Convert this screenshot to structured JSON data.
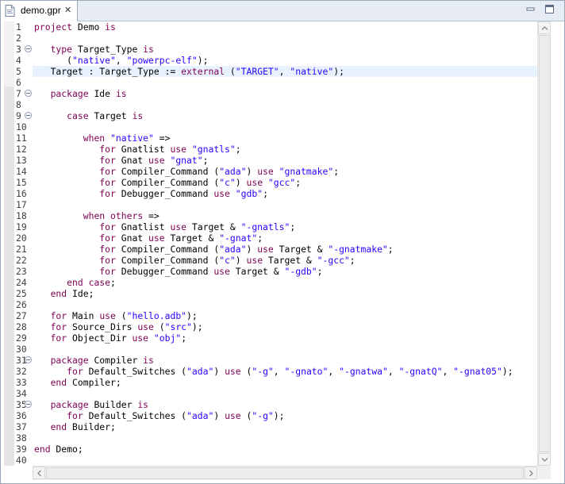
{
  "tab": {
    "title": "demo.gpr",
    "icon": "gpr-file-icon",
    "close_symbol": "✕"
  },
  "window_controls": [
    "minimize-icon",
    "maximize-icon"
  ],
  "colors": {
    "keyword": "#7f0055",
    "string": "#2a00ff",
    "current_line": "#e8f2fe",
    "line_number": "#3f3f3f"
  },
  "editor": {
    "current_line": 5,
    "lines": [
      {
        "n": "1",
        "fold": false,
        "tokens": [
          [
            "k",
            "project"
          ],
          [
            "t",
            " Demo "
          ],
          [
            "k",
            "is"
          ]
        ]
      },
      {
        "n": "2",
        "fold": false,
        "tokens": []
      },
      {
        "n": "3",
        "fold": true,
        "tokens": [
          [
            "t",
            "   "
          ],
          [
            "k",
            "type"
          ],
          [
            "t",
            " Target_Type "
          ],
          [
            "k",
            "is"
          ]
        ]
      },
      {
        "n": "4",
        "fold": false,
        "tokens": [
          [
            "t",
            "      ("
          ],
          [
            "s",
            "\"native\""
          ],
          [
            "t",
            ", "
          ],
          [
            "s",
            "\"powerpc-elf\""
          ],
          [
            "t",
            ");"
          ]
        ]
      },
      {
        "n": "5",
        "fold": false,
        "tokens": [
          [
            "t",
            "   Target : Target_Type := "
          ],
          [
            "k",
            "external"
          ],
          [
            "t",
            " ("
          ],
          [
            "s",
            "\"TARGET\""
          ],
          [
            "t",
            ", "
          ],
          [
            "s",
            "\"native\""
          ],
          [
            "t",
            ");"
          ]
        ]
      },
      {
        "n": "6",
        "fold": false,
        "tokens": []
      },
      {
        "n": "7",
        "fold": true,
        "tokens": [
          [
            "t",
            "   "
          ],
          [
            "k",
            "package"
          ],
          [
            "t",
            " Ide "
          ],
          [
            "k",
            "is"
          ]
        ]
      },
      {
        "n": "8",
        "fold": false,
        "tokens": []
      },
      {
        "n": "9",
        "fold": true,
        "tokens": [
          [
            "t",
            "      "
          ],
          [
            "k",
            "case"
          ],
          [
            "t",
            " Target "
          ],
          [
            "k",
            "is"
          ]
        ]
      },
      {
        "n": "10",
        "fold": false,
        "tokens": []
      },
      {
        "n": "11",
        "fold": false,
        "tokens": [
          [
            "t",
            "         "
          ],
          [
            "k",
            "when"
          ],
          [
            "t",
            " "
          ],
          [
            "s",
            "\"native\""
          ],
          [
            "t",
            " =>"
          ]
        ]
      },
      {
        "n": "12",
        "fold": false,
        "tokens": [
          [
            "t",
            "            "
          ],
          [
            "k",
            "for"
          ],
          [
            "t",
            " Gnatlist "
          ],
          [
            "k",
            "use"
          ],
          [
            "t",
            " "
          ],
          [
            "s",
            "\"gnatls\""
          ],
          [
            "t",
            ";"
          ]
        ]
      },
      {
        "n": "13",
        "fold": false,
        "tokens": [
          [
            "t",
            "            "
          ],
          [
            "k",
            "for"
          ],
          [
            "t",
            " Gnat "
          ],
          [
            "k",
            "use"
          ],
          [
            "t",
            " "
          ],
          [
            "s",
            "\"gnat\""
          ],
          [
            "t",
            ";"
          ]
        ]
      },
      {
        "n": "14",
        "fold": false,
        "tokens": [
          [
            "t",
            "            "
          ],
          [
            "k",
            "for"
          ],
          [
            "t",
            " Compiler_Command ("
          ],
          [
            "s",
            "\"ada\""
          ],
          [
            "t",
            ") "
          ],
          [
            "k",
            "use"
          ],
          [
            "t",
            " "
          ],
          [
            "s",
            "\"gnatmake\""
          ],
          [
            "t",
            ";"
          ]
        ]
      },
      {
        "n": "15",
        "fold": false,
        "tokens": [
          [
            "t",
            "            "
          ],
          [
            "k",
            "for"
          ],
          [
            "t",
            " Compiler_Command ("
          ],
          [
            "s",
            "\"c\""
          ],
          [
            "t",
            ") "
          ],
          [
            "k",
            "use"
          ],
          [
            "t",
            " "
          ],
          [
            "s",
            "\"gcc\""
          ],
          [
            "t",
            ";"
          ]
        ]
      },
      {
        "n": "16",
        "fold": false,
        "tokens": [
          [
            "t",
            "            "
          ],
          [
            "k",
            "for"
          ],
          [
            "t",
            " Debugger_Command "
          ],
          [
            "k",
            "use"
          ],
          [
            "t",
            " "
          ],
          [
            "s",
            "\"gdb\""
          ],
          [
            "t",
            ";"
          ]
        ]
      },
      {
        "n": "17",
        "fold": false,
        "tokens": []
      },
      {
        "n": "18",
        "fold": false,
        "tokens": [
          [
            "t",
            "         "
          ],
          [
            "k",
            "when"
          ],
          [
            "t",
            " "
          ],
          [
            "k",
            "others"
          ],
          [
            "t",
            " =>"
          ]
        ]
      },
      {
        "n": "19",
        "fold": false,
        "tokens": [
          [
            "t",
            "            "
          ],
          [
            "k",
            "for"
          ],
          [
            "t",
            " Gnatlist "
          ],
          [
            "k",
            "use"
          ],
          [
            "t",
            " Target & "
          ],
          [
            "s",
            "\"-gnatls\""
          ],
          [
            "t",
            ";"
          ]
        ]
      },
      {
        "n": "20",
        "fold": false,
        "tokens": [
          [
            "t",
            "            "
          ],
          [
            "k",
            "for"
          ],
          [
            "t",
            " Gnat "
          ],
          [
            "k",
            "use"
          ],
          [
            "t",
            " Target & "
          ],
          [
            "s",
            "\"-gnat\""
          ],
          [
            "t",
            ";"
          ]
        ]
      },
      {
        "n": "21",
        "fold": false,
        "tokens": [
          [
            "t",
            "            "
          ],
          [
            "k",
            "for"
          ],
          [
            "t",
            " Compiler_Command ("
          ],
          [
            "s",
            "\"ada\""
          ],
          [
            "t",
            ") "
          ],
          [
            "k",
            "use"
          ],
          [
            "t",
            " Target & "
          ],
          [
            "s",
            "\"-gnatmake\""
          ],
          [
            "t",
            ";"
          ]
        ]
      },
      {
        "n": "22",
        "fold": false,
        "tokens": [
          [
            "t",
            "            "
          ],
          [
            "k",
            "for"
          ],
          [
            "t",
            " Compiler_Command ("
          ],
          [
            "s",
            "\"c\""
          ],
          [
            "t",
            ") "
          ],
          [
            "k",
            "use"
          ],
          [
            "t",
            " Target & "
          ],
          [
            "s",
            "\"-gcc\""
          ],
          [
            "t",
            ";"
          ]
        ]
      },
      {
        "n": "23",
        "fold": false,
        "tokens": [
          [
            "t",
            "            "
          ],
          [
            "k",
            "for"
          ],
          [
            "t",
            " Debugger_Command "
          ],
          [
            "k",
            "use"
          ],
          [
            "t",
            " Target & "
          ],
          [
            "s",
            "\"-gdb\""
          ],
          [
            "t",
            ";"
          ]
        ]
      },
      {
        "n": "24",
        "fold": false,
        "tokens": [
          [
            "t",
            "      "
          ],
          [
            "k",
            "end"
          ],
          [
            "t",
            " "
          ],
          [
            "k",
            "case"
          ],
          [
            "t",
            ";"
          ]
        ]
      },
      {
        "n": "25",
        "fold": false,
        "tokens": [
          [
            "t",
            "   "
          ],
          [
            "k",
            "end"
          ],
          [
            "t",
            " Ide;"
          ]
        ]
      },
      {
        "n": "26",
        "fold": false,
        "tokens": []
      },
      {
        "n": "27",
        "fold": false,
        "tokens": [
          [
            "t",
            "   "
          ],
          [
            "k",
            "for"
          ],
          [
            "t",
            " Main "
          ],
          [
            "k",
            "use"
          ],
          [
            "t",
            " ("
          ],
          [
            "s",
            "\"hello.adb\""
          ],
          [
            "t",
            ");"
          ]
        ]
      },
      {
        "n": "28",
        "fold": false,
        "tokens": [
          [
            "t",
            "   "
          ],
          [
            "k",
            "for"
          ],
          [
            "t",
            " Source_Dirs "
          ],
          [
            "k",
            "use"
          ],
          [
            "t",
            " ("
          ],
          [
            "s",
            "\"src\""
          ],
          [
            "t",
            ");"
          ]
        ]
      },
      {
        "n": "29",
        "fold": false,
        "tokens": [
          [
            "t",
            "   "
          ],
          [
            "k",
            "for"
          ],
          [
            "t",
            " Object_Dir "
          ],
          [
            "k",
            "use"
          ],
          [
            "t",
            " "
          ],
          [
            "s",
            "\"obj\""
          ],
          [
            "t",
            ";"
          ]
        ]
      },
      {
        "n": "30",
        "fold": false,
        "tokens": []
      },
      {
        "n": "31",
        "fold": true,
        "tokens": [
          [
            "t",
            "   "
          ],
          [
            "k",
            "package"
          ],
          [
            "t",
            " Compiler "
          ],
          [
            "k",
            "is"
          ]
        ]
      },
      {
        "n": "32",
        "fold": false,
        "tokens": [
          [
            "t",
            "      "
          ],
          [
            "k",
            "for"
          ],
          [
            "t",
            " Default_Switches ("
          ],
          [
            "s",
            "\"ada\""
          ],
          [
            "t",
            ") "
          ],
          [
            "k",
            "use"
          ],
          [
            "t",
            " ("
          ],
          [
            "s",
            "\"-g\""
          ],
          [
            "t",
            ", "
          ],
          [
            "s",
            "\"-gnato\""
          ],
          [
            "t",
            ", "
          ],
          [
            "s",
            "\"-gnatwa\""
          ],
          [
            "t",
            ", "
          ],
          [
            "s",
            "\"-gnatQ\""
          ],
          [
            "t",
            ", "
          ],
          [
            "s",
            "\"-gnat05\""
          ],
          [
            "t",
            ");"
          ]
        ]
      },
      {
        "n": "33",
        "fold": false,
        "tokens": [
          [
            "t",
            "   "
          ],
          [
            "k",
            "end"
          ],
          [
            "t",
            " Compiler;"
          ]
        ]
      },
      {
        "n": "34",
        "fold": false,
        "tokens": []
      },
      {
        "n": "35",
        "fold": true,
        "tokens": [
          [
            "t",
            "   "
          ],
          [
            "k",
            "package"
          ],
          [
            "t",
            " Builder "
          ],
          [
            "k",
            "is"
          ]
        ]
      },
      {
        "n": "36",
        "fold": false,
        "tokens": [
          [
            "t",
            "      "
          ],
          [
            "k",
            "for"
          ],
          [
            "t",
            " Default_Switches ("
          ],
          [
            "s",
            "\"ada\""
          ],
          [
            "t",
            ") "
          ],
          [
            "k",
            "use"
          ],
          [
            "t",
            " ("
          ],
          [
            "s",
            "\"-g\""
          ],
          [
            "t",
            ");"
          ]
        ]
      },
      {
        "n": "37",
        "fold": false,
        "tokens": [
          [
            "t",
            "   "
          ],
          [
            "k",
            "end"
          ],
          [
            "t",
            " Builder;"
          ]
        ]
      },
      {
        "n": "38",
        "fold": false,
        "tokens": []
      },
      {
        "n": "39",
        "fold": false,
        "tokens": [
          [
            "k",
            "end"
          ],
          [
            "t",
            " Demo;"
          ]
        ]
      },
      {
        "n": "40",
        "fold": false,
        "tokens": []
      }
    ]
  }
}
